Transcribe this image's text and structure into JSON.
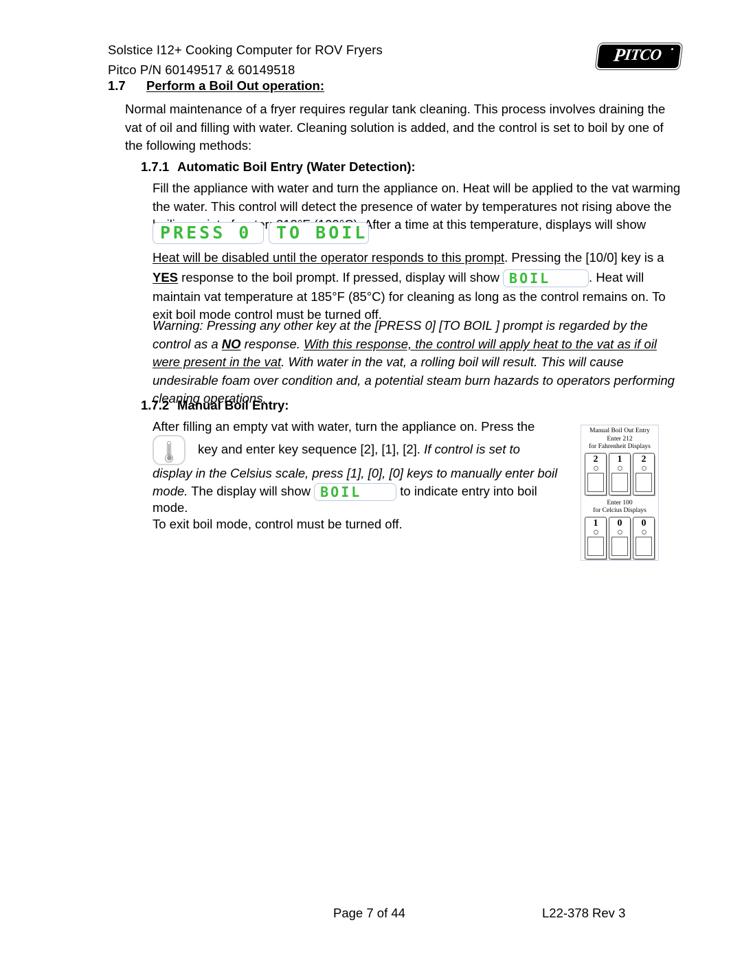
{
  "document": {
    "header": {
      "line1": "Solstice I12+ Cooking Computer for ROV Fryers",
      "line2": "Pitco P/N 60149517 & 60149518",
      "logo_text": "PITCO",
      "logo_name": "pitco-logo"
    },
    "section_17": {
      "number": "1.7",
      "title": "Perform a Boil Out operation:",
      "intro": [
        "Normal maintenance of a fryer requires regular tank cleaning.  This process involves draining the",
        "vat of oil and filling with water.  Cleaning solution is added, and the control is set to boil by one of",
        "the following methods:"
      ]
    },
    "section_171": {
      "number": "1.7.1",
      "title": "Automatic Boil Entry (Water Detection):",
      "body": [
        "Fill the appliance with water and turn the appliance on.  Heat will be applied to the vat warming",
        "the water.  This control will detect the presence of water by temperatures not rising above the",
        "boiling point of water; 212°F (100°C).  After a time at this temperature, displays will show"
      ],
      "lcd_press": "PRESS 0",
      "lcd_toboil": "TO BOIL",
      "after_lcd": {
        "line1_a": "Heat will be disabled until the operator responds to this prompt",
        "line1_b": ".  Pressing the [10/0] key is a",
        "line2_a": "YES",
        "line2_b": " response to the boil prompt.  If pressed, display will show ",
        "lcd_boil": "BOIL",
        "line2_c": ". Heat will",
        "line3": "maintain vat temperature at 185°F (85°C) for cleaning as long as the control remains on.  To",
        "line4": "exit boil mode control must be turned off."
      },
      "warning": {
        "line1": "Warning: Pressing any other key at the [PRESS 0] [TO BOIL ] prompt is regarded by the",
        "line2_a": "control as a ",
        "line2_b": "NO",
        "line2_c": " response.  ",
        "line2_d": "With this response, the control will apply heat to the vat as if oil",
        "line3_a": "were present in the vat",
        "line3_b": ". With water in the vat, a rolling boil will result. This will cause",
        "line4": "undesirable foam over condition and, a potential steam burn hazards to operators performing",
        "line5": "cleaning operations."
      }
    },
    "section_172": {
      "number": "1.7.2",
      "title": "Manual Boil Entry:",
      "line1": "After filling an empty vat with water, turn the appliance on.  Press the",
      "therm_icon": "thermometer-icon",
      "line2_a": "key and enter key sequence [2], [1], [2].  ",
      "line2_b": "If control is set to",
      "line3": "display in the Celsius scale, press [1], [0], [0] keys to manually enter boil",
      "line4_a": "mode.",
      "line4_b": "  The display will show ",
      "lcd_boil": "BOIL",
      "line4_c": " to indicate entry into boil",
      "line5": "mode.",
      "line6": "To exit boil mode, control must be turned off."
    },
    "keypad_diagram": {
      "caption_top_1": "Manual Boil Out Entry",
      "caption_top_2": "Enter 212",
      "caption_top_3": "for Fahrenheit Displays",
      "keys_top": [
        "2",
        "1",
        "2"
      ],
      "caption_bottom_1": "Enter 100",
      "caption_bottom_2": "for Celcius Displays",
      "keys_bottom": [
        "1",
        "0",
        "0"
      ]
    },
    "footer": {
      "page": "Page 7 of 44",
      "revision": "L22-378 Rev 3"
    },
    "colors": {
      "lcd_green": "#3bbb3b",
      "lcd_border": "#b8c9de",
      "text": "#000000"
    }
  }
}
